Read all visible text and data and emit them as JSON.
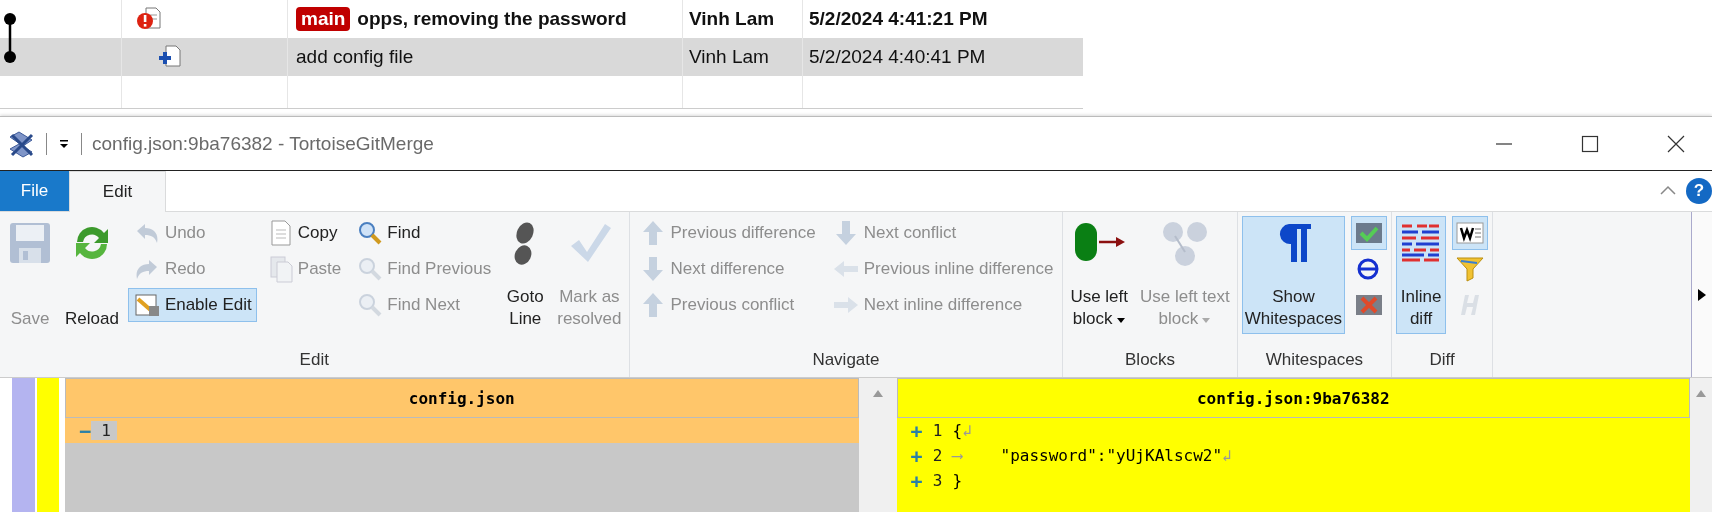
{
  "log": {
    "rows": [
      {
        "current": true,
        "selected": false,
        "kind": "modified",
        "branch": "main",
        "message": "opps, removing the password",
        "author": "Vinh Lam",
        "date": "5/2/2024 4:41:21 PM"
      },
      {
        "current": false,
        "selected": true,
        "kind": "added",
        "message": "add config file",
        "author": "Vinh Lam",
        "date": "5/2/2024 4:40:41 PM"
      }
    ]
  },
  "window": {
    "title": "config.json:9ba76382 - TortoiseGitMerge"
  },
  "ribbon": {
    "tabs": [
      {
        "label": "File",
        "kind": "file",
        "selected": false
      },
      {
        "label": "Edit",
        "kind": "tab",
        "selected": true
      }
    ],
    "help": "?",
    "groups": [
      {
        "label": "Edit",
        "items": [
          {
            "kind": "large",
            "label": "Save",
            "disabled": true,
            "on": false
          },
          {
            "kind": "large",
            "label": "Reload",
            "disabled": false,
            "on": false
          },
          {
            "kind": "stack",
            "items": [
              {
                "label": "Undo",
                "disabled": true,
                "on": false
              },
              {
                "label": "Redo",
                "disabled": true,
                "on": false
              },
              {
                "label": "Enable Edit",
                "disabled": false,
                "on": true
              }
            ]
          },
          {
            "kind": "stack",
            "items": [
              {
                "label": "Copy",
                "disabled": false,
                "on": false
              },
              {
                "label": "Paste",
                "disabled": true,
                "on": false
              }
            ]
          },
          {
            "kind": "stack",
            "items": [
              {
                "label": "Find",
                "disabled": false,
                "on": false
              },
              {
                "label": "Find Previous",
                "disabled": true,
                "on": false
              },
              {
                "label": "Find Next",
                "disabled": true,
                "on": false
              }
            ]
          },
          {
            "kind": "large",
            "label": "Goto\nLine",
            "disabled": false,
            "on": false
          },
          {
            "kind": "large",
            "label": "Mark as\nresolved",
            "disabled": true,
            "on": false
          }
        ]
      },
      {
        "label": "Navigate",
        "items": [
          {
            "kind": "stack",
            "items": [
              {
                "label": "Previous difference",
                "disabled": true,
                "on": false
              },
              {
                "label": "Next difference",
                "disabled": true,
                "on": false
              },
              {
                "label": "Previous conflict",
                "disabled": true,
                "on": false
              }
            ]
          },
          {
            "kind": "stack",
            "items": [
              {
                "label": "Next conflict",
                "disabled": true,
                "on": false
              },
              {
                "label": "Previous inline difference",
                "disabled": true,
                "on": false
              },
              {
                "label": "Next inline difference",
                "disabled": true,
                "on": false
              }
            ]
          }
        ]
      },
      {
        "label": "Blocks",
        "items": [
          {
            "kind": "large",
            "label": "Use left\nblock",
            "dropdown": true,
            "disabled": false,
            "on": false
          },
          {
            "kind": "large",
            "label": "Use left text\nblock",
            "dropdown": true,
            "disabled": true,
            "on": false
          }
        ]
      },
      {
        "label": "Whitespaces",
        "items": [
          {
            "kind": "large",
            "label": "Show\nWhitespaces",
            "disabled": false,
            "on": true
          },
          {
            "kind": "stack",
            "items": [
              {
                "disabled": false,
                "on": true
              },
              {
                "disabled": false,
                "on": false
              },
              {
                "disabled": false,
                "on": false
              }
            ]
          }
        ]
      },
      {
        "label": "Diff",
        "items": [
          {
            "kind": "large",
            "label": "Inline\ndiff",
            "disabled": false,
            "on": true
          },
          {
            "kind": "stack",
            "items": [
              {
                "disabled": false,
                "on": true
              },
              {
                "disabled": false,
                "on": false
              },
              {
                "disabled": true,
                "on": false
              }
            ]
          }
        ]
      }
    ]
  },
  "panes": [
    {
      "title": "config.json",
      "kind": "removed",
      "lines": [
        {
          "number": "1",
          "marker": "−",
          "kind": "removed"
        }
      ]
    },
    {
      "title": "config.json:9ba76382",
      "kind": "added",
      "lines": [
        {
          "number": "1",
          "marker": "+",
          "kind": "added",
          "text": "{",
          "eol": "↲"
        },
        {
          "number": "2",
          "marker": "+",
          "kind": "added",
          "tab": "⟶",
          "text": "\"password\":\"yUjKAlscw2\"",
          "eol": "↲"
        },
        {
          "number": "3",
          "marker": "+",
          "kind": "added",
          "text": "}"
        }
      ]
    }
  ]
}
